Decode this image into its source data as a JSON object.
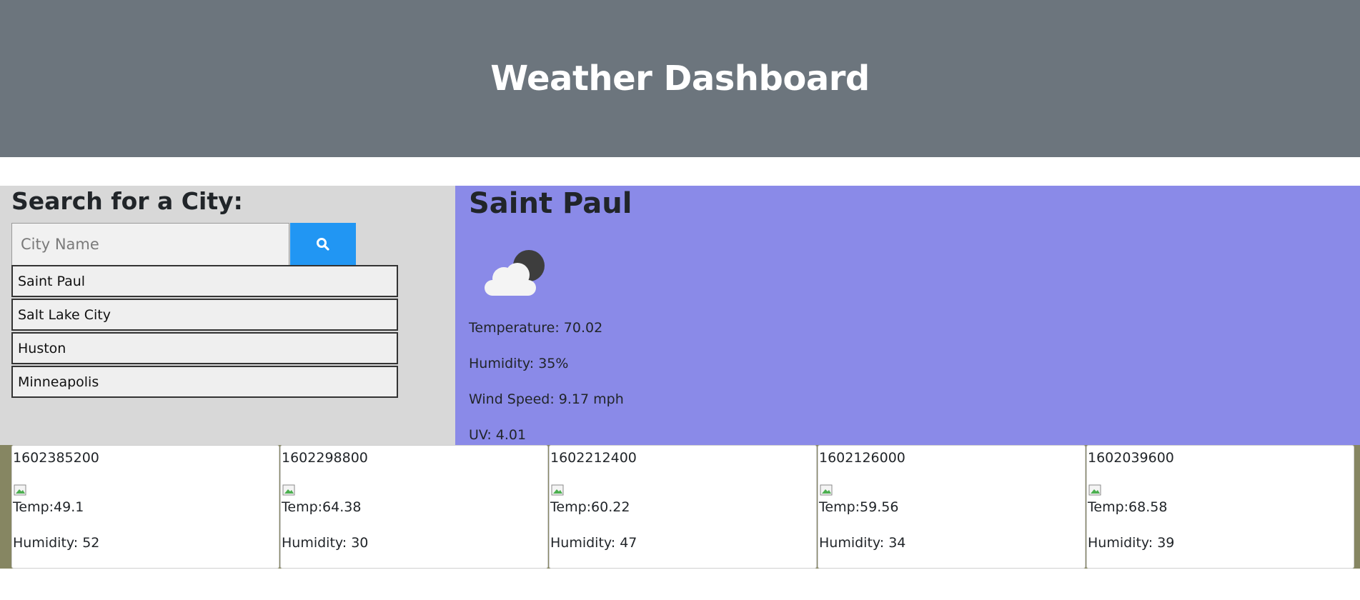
{
  "header": {
    "title": "Weather Dashboard"
  },
  "search": {
    "title": "Search for a City:",
    "placeholder": "City Name",
    "button_icon": "search-icon"
  },
  "history": [
    {
      "label": "Saint Paul"
    },
    {
      "label": "Salt Lake City"
    },
    {
      "label": "Huston"
    },
    {
      "label": "Minneapolis"
    }
  ],
  "current": {
    "city": "Saint Paul",
    "icon": "partly-cloudy-night-icon",
    "temperature": "Temperature: 70.02",
    "humidity": "Humidity: 35%",
    "wind": "Wind Speed: 9.17 mph",
    "uv": "UV: 4.01"
  },
  "forecast": [
    {
      "date": "1602385200",
      "temp": "Temp:49.1",
      "humidity": "Humidity: 52"
    },
    {
      "date": "1602298800",
      "temp": "Temp:64.38",
      "humidity": "Humidity: 30"
    },
    {
      "date": "1602212400",
      "temp": "Temp:60.22",
      "humidity": "Humidity: 47"
    },
    {
      "date": "1602126000",
      "temp": "Temp:59.56",
      "humidity": "Humidity: 34"
    },
    {
      "date": "1602039600",
      "temp": "Temp:68.58",
      "humidity": "Humidity: 39"
    }
  ],
  "colors": {
    "header_bg": "#6c757d",
    "search_panel_bg": "#d8d8d8",
    "search_button_bg": "#2196f3",
    "current_bg": "#8a8ae8",
    "forecast_strip_bg": "#868662"
  }
}
